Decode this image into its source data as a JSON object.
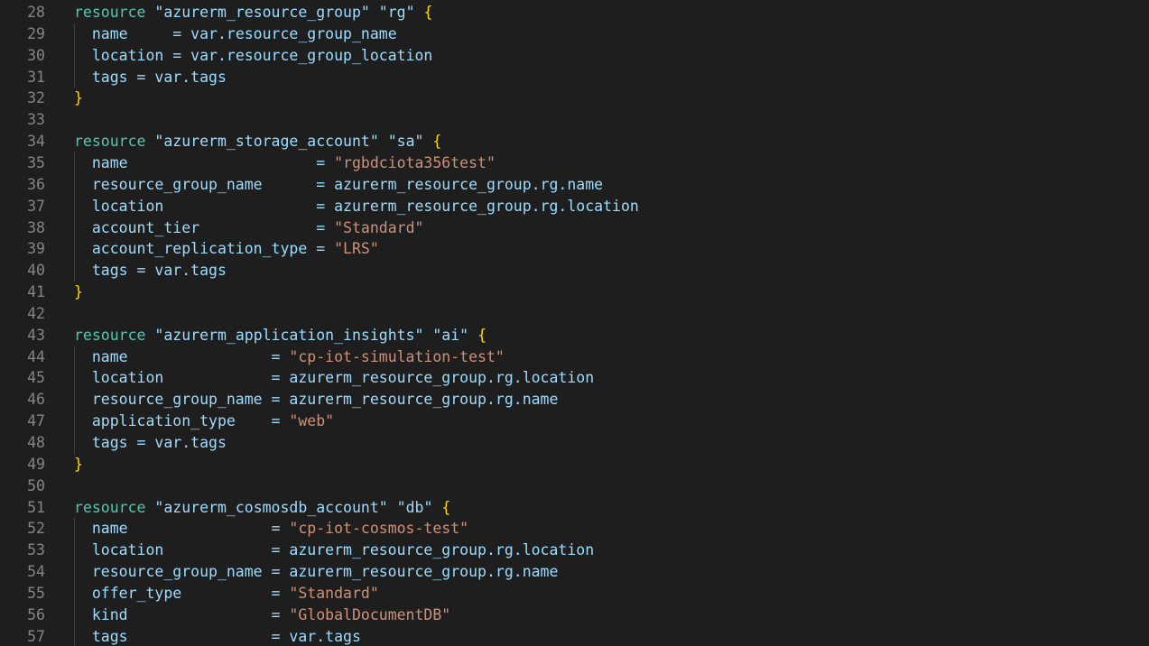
{
  "colors": {
    "background": "#1e1e1e",
    "line_number": "#858585",
    "keyword": "#4ec9b0",
    "label": "#9cdcfe",
    "brace": "#ffd700",
    "attribute": "#9cdcfe",
    "string": "#ce9178",
    "plain": "#d4d4d4",
    "indent_guide": "#404040"
  },
  "lines": [
    {
      "n": "28",
      "tokens": [
        {
          "t": "resource",
          "c": "kw"
        },
        {
          "t": " ",
          "c": "plain"
        },
        {
          "t": "\"azurerm_resource_group\"",
          "c": "str"
        },
        {
          "t": " ",
          "c": "plain"
        },
        {
          "t": "\"rg\"",
          "c": "str"
        },
        {
          "t": " ",
          "c": "plain"
        },
        {
          "t": "{",
          "c": "brace"
        }
      ]
    },
    {
      "n": "29",
      "tokens": [
        {
          "t": "  name     ",
          "c": "attr"
        },
        {
          "t": "= var.resource_group_name",
          "c": "attr"
        }
      ]
    },
    {
      "n": "30",
      "tokens": [
        {
          "t": "  location ",
          "c": "attr"
        },
        {
          "t": "= var.resource_group_location",
          "c": "attr"
        }
      ]
    },
    {
      "n": "31",
      "tokens": [
        {
          "t": "  tags ",
          "c": "attr"
        },
        {
          "t": "= var.tags",
          "c": "attr"
        }
      ]
    },
    {
      "n": "32",
      "tokens": [
        {
          "t": "}",
          "c": "brace"
        }
      ]
    },
    {
      "n": "33",
      "tokens": []
    },
    {
      "n": "34",
      "tokens": [
        {
          "t": "resource",
          "c": "kw"
        },
        {
          "t": " ",
          "c": "plain"
        },
        {
          "t": "\"azurerm_storage_account\"",
          "c": "str"
        },
        {
          "t": " ",
          "c": "plain"
        },
        {
          "t": "\"sa\"",
          "c": "str"
        },
        {
          "t": " ",
          "c": "plain"
        },
        {
          "t": "{",
          "c": "brace"
        }
      ]
    },
    {
      "n": "35",
      "tokens": [
        {
          "t": "  name                     = ",
          "c": "attr"
        },
        {
          "t": "\"rgbdciota356test\"",
          "c": "val"
        }
      ]
    },
    {
      "n": "36",
      "tokens": [
        {
          "t": "  resource_group_name      = azurerm_resource_group.rg.name",
          "c": "attr"
        }
      ]
    },
    {
      "n": "37",
      "tokens": [
        {
          "t": "  location                 = azurerm_resource_group.rg.location",
          "c": "attr"
        }
      ]
    },
    {
      "n": "38",
      "tokens": [
        {
          "t": "  account_tier             = ",
          "c": "attr"
        },
        {
          "t": "\"Standard\"",
          "c": "val"
        }
      ]
    },
    {
      "n": "39",
      "tokens": [
        {
          "t": "  account_replication_type = ",
          "c": "attr"
        },
        {
          "t": "\"LRS\"",
          "c": "val"
        }
      ]
    },
    {
      "n": "40",
      "tokens": [
        {
          "t": "  tags = var.tags",
          "c": "attr"
        }
      ]
    },
    {
      "n": "41",
      "tokens": [
        {
          "t": "}",
          "c": "brace"
        }
      ]
    },
    {
      "n": "42",
      "tokens": []
    },
    {
      "n": "43",
      "tokens": [
        {
          "t": "resource",
          "c": "kw"
        },
        {
          "t": " ",
          "c": "plain"
        },
        {
          "t": "\"azurerm_application_insights\"",
          "c": "str"
        },
        {
          "t": " ",
          "c": "plain"
        },
        {
          "t": "\"ai\"",
          "c": "str"
        },
        {
          "t": " ",
          "c": "plain"
        },
        {
          "t": "{",
          "c": "brace"
        }
      ]
    },
    {
      "n": "44",
      "tokens": [
        {
          "t": "  name                = ",
          "c": "attr"
        },
        {
          "t": "\"cp-iot-simulation-test\"",
          "c": "val"
        }
      ]
    },
    {
      "n": "45",
      "tokens": [
        {
          "t": "  location            = azurerm_resource_group.rg.location",
          "c": "attr"
        }
      ]
    },
    {
      "n": "46",
      "tokens": [
        {
          "t": "  resource_group_name = azurerm_resource_group.rg.name",
          "c": "attr"
        }
      ]
    },
    {
      "n": "47",
      "tokens": [
        {
          "t": "  application_type    = ",
          "c": "attr"
        },
        {
          "t": "\"web\"",
          "c": "val"
        }
      ]
    },
    {
      "n": "48",
      "tokens": [
        {
          "t": "  tags = var.tags",
          "c": "attr"
        }
      ]
    },
    {
      "n": "49",
      "tokens": [
        {
          "t": "}",
          "c": "brace"
        }
      ]
    },
    {
      "n": "50",
      "tokens": []
    },
    {
      "n": "51",
      "tokens": [
        {
          "t": "resource",
          "c": "kw"
        },
        {
          "t": " ",
          "c": "plain"
        },
        {
          "t": "\"azurerm_cosmosdb_account\"",
          "c": "str"
        },
        {
          "t": " ",
          "c": "plain"
        },
        {
          "t": "\"db\"",
          "c": "str"
        },
        {
          "t": " ",
          "c": "plain"
        },
        {
          "t": "{",
          "c": "brace"
        }
      ]
    },
    {
      "n": "52",
      "tokens": [
        {
          "t": "  name                = ",
          "c": "attr"
        },
        {
          "t": "\"cp-iot-cosmos-test\"",
          "c": "val"
        }
      ]
    },
    {
      "n": "53",
      "tokens": [
        {
          "t": "  location            = azurerm_resource_group.rg.location",
          "c": "attr"
        }
      ]
    },
    {
      "n": "54",
      "tokens": [
        {
          "t": "  resource_group_name = azurerm_resource_group.rg.name",
          "c": "attr"
        }
      ]
    },
    {
      "n": "55",
      "tokens": [
        {
          "t": "  offer_type          = ",
          "c": "attr"
        },
        {
          "t": "\"Standard\"",
          "c": "val"
        }
      ]
    },
    {
      "n": "56",
      "tokens": [
        {
          "t": "  kind                = ",
          "c": "attr"
        },
        {
          "t": "\"GlobalDocumentDB\"",
          "c": "val"
        }
      ]
    },
    {
      "n": "57",
      "tokens": [
        {
          "t": "  tags                = var.tags",
          "c": "attr"
        }
      ]
    }
  ]
}
